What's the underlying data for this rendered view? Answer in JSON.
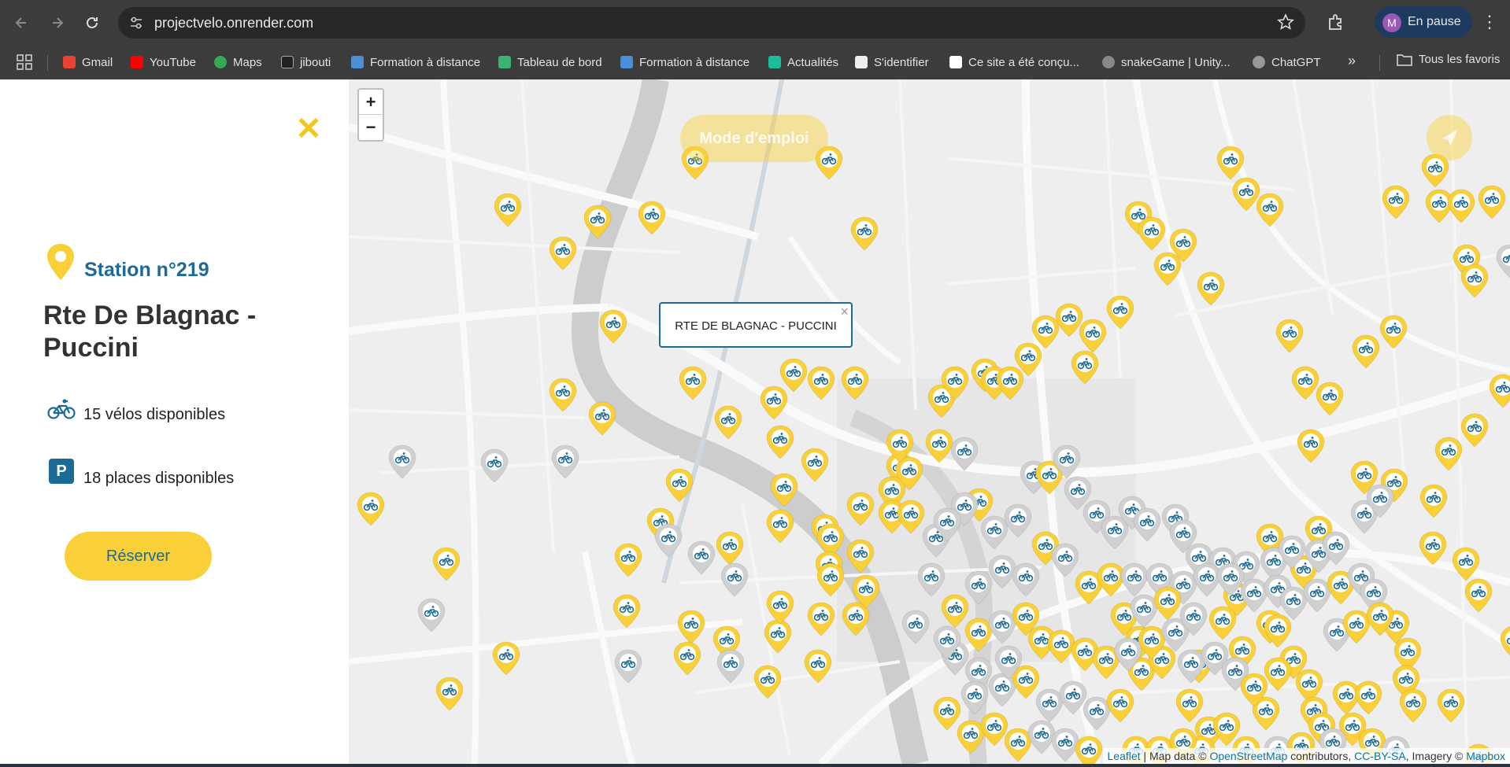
{
  "browser": {
    "url": "projectvelo.onrender.com",
    "profile_initial": "M",
    "profile_label": "En pause",
    "bookmarks": [
      "Gmail",
      "YouTube",
      "Maps",
      "jibouti",
      "Formation à distance",
      "Tableau de bord",
      "Formation à distance",
      "Actualités",
      "S'identifier",
      "Ce site a été conçu...",
      "snakeGame | Unity...",
      "ChatGPT"
    ],
    "bookmarks_more": "»",
    "bookmarks_folder": "Tous les favoris"
  },
  "panel": {
    "close_label": "✕",
    "station_number": "Station n°219",
    "station_name": "Rte De Blagnac - Puccini",
    "bikes_available": "15 vélos disponibles",
    "places_available": "18 places disponibles",
    "reserve_label": "Réserver",
    "parking_letter": "P"
  },
  "map": {
    "zoom_in": "+",
    "zoom_out": "−",
    "mode_emploi": "Mode d'emploi",
    "popup_text": "RTE DE BLAGNAC - PUCCINI",
    "popup_close": "×",
    "attribution": {
      "leaflet": "Leaflet",
      "sep": " | Map data © ",
      "osm": "OpenStreetMap",
      "contrib": " contributors, ",
      "license": "CC-BY-SA",
      "imagery": ", Imagery © ",
      "mapbox": "Mapbox"
    }
  },
  "colors": {
    "brand_yellow": "#f9d037",
    "brand_blue": "#1c6b96",
    "marker_grey": "#d0d0d0"
  }
}
